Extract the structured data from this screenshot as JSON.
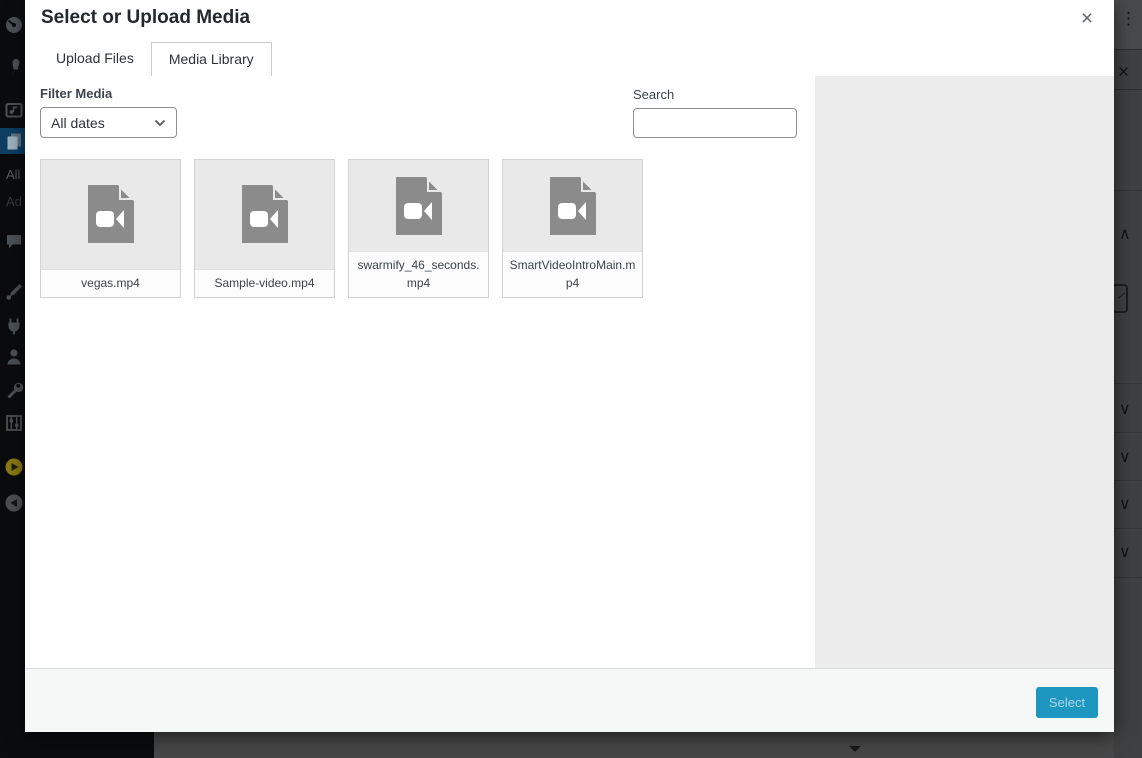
{
  "colors": {
    "accent_blue": "#1e97c0",
    "admin_highlight_blue": "#0e3f63",
    "overlay_gray": "#474747",
    "details_panel_gray": "#ececec"
  },
  "admin_sidebar": {
    "submenu": {
      "item1": "All",
      "item2": "Ad"
    }
  },
  "background_editor": {
    "more_options_glyph": "⋮",
    "close_glyph": "×",
    "collapse_glyph": "∧",
    "expand_glyph": "∨"
  },
  "modal": {
    "title": "Select or Upload Media",
    "close_glyph": "×",
    "tabs": [
      {
        "label": "Upload Files"
      },
      {
        "label": "Media Library"
      }
    ],
    "toolbar": {
      "filter_label": "Filter Media",
      "filter_value": "All dates",
      "search_label": "Search",
      "search_value": ""
    },
    "items": [
      {
        "filename": "vegas.mp4"
      },
      {
        "filename": "Sample-video.mp4"
      },
      {
        "filename": "swarmify_46_seconds.mp4"
      },
      {
        "filename": "SmartVideoIntroMain.mp4"
      }
    ],
    "footer": {
      "select_label": "Select"
    }
  }
}
